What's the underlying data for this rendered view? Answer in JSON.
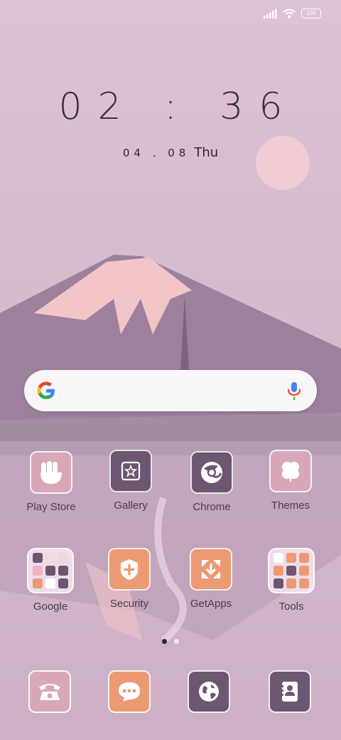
{
  "status_bar": {
    "battery": "100",
    "icons": [
      "signal-icon",
      "wifi-icon",
      "battery-icon"
    ]
  },
  "clock": {
    "time": "02 : 36",
    "date_numbers": "04 . 08",
    "weekday": "Thu"
  },
  "search": {
    "icons": [
      "google-g-icon",
      "microphone-icon"
    ]
  },
  "apps_row1": [
    {
      "label": "Play Store",
      "icon": "play-store-icon"
    },
    {
      "label": "Gallery",
      "icon": "gallery-icon"
    },
    {
      "label": "Chrome",
      "icon": "chrome-icon"
    },
    {
      "label": "Themes",
      "icon": "themes-icon"
    }
  ],
  "apps_row2": [
    {
      "label": "Google",
      "icon": "google-folder-icon"
    },
    {
      "label": "Security",
      "icon": "security-icon"
    },
    {
      "label": "GetApps",
      "icon": "getapps-icon"
    },
    {
      "label": "Tools",
      "icon": "tools-folder-icon"
    }
  ],
  "dock": [
    {
      "icon": "phone-icon"
    },
    {
      "icon": "messages-icon"
    },
    {
      "icon": "browser-icon"
    },
    {
      "icon": "contacts-icon"
    }
  ],
  "page_indicator": {
    "pages": 2,
    "current": 1
  },
  "colors": {
    "tile_pink": "#d9a8b8",
    "tile_purple": "#6d5672",
    "tile_orange": "#ec9a74"
  }
}
